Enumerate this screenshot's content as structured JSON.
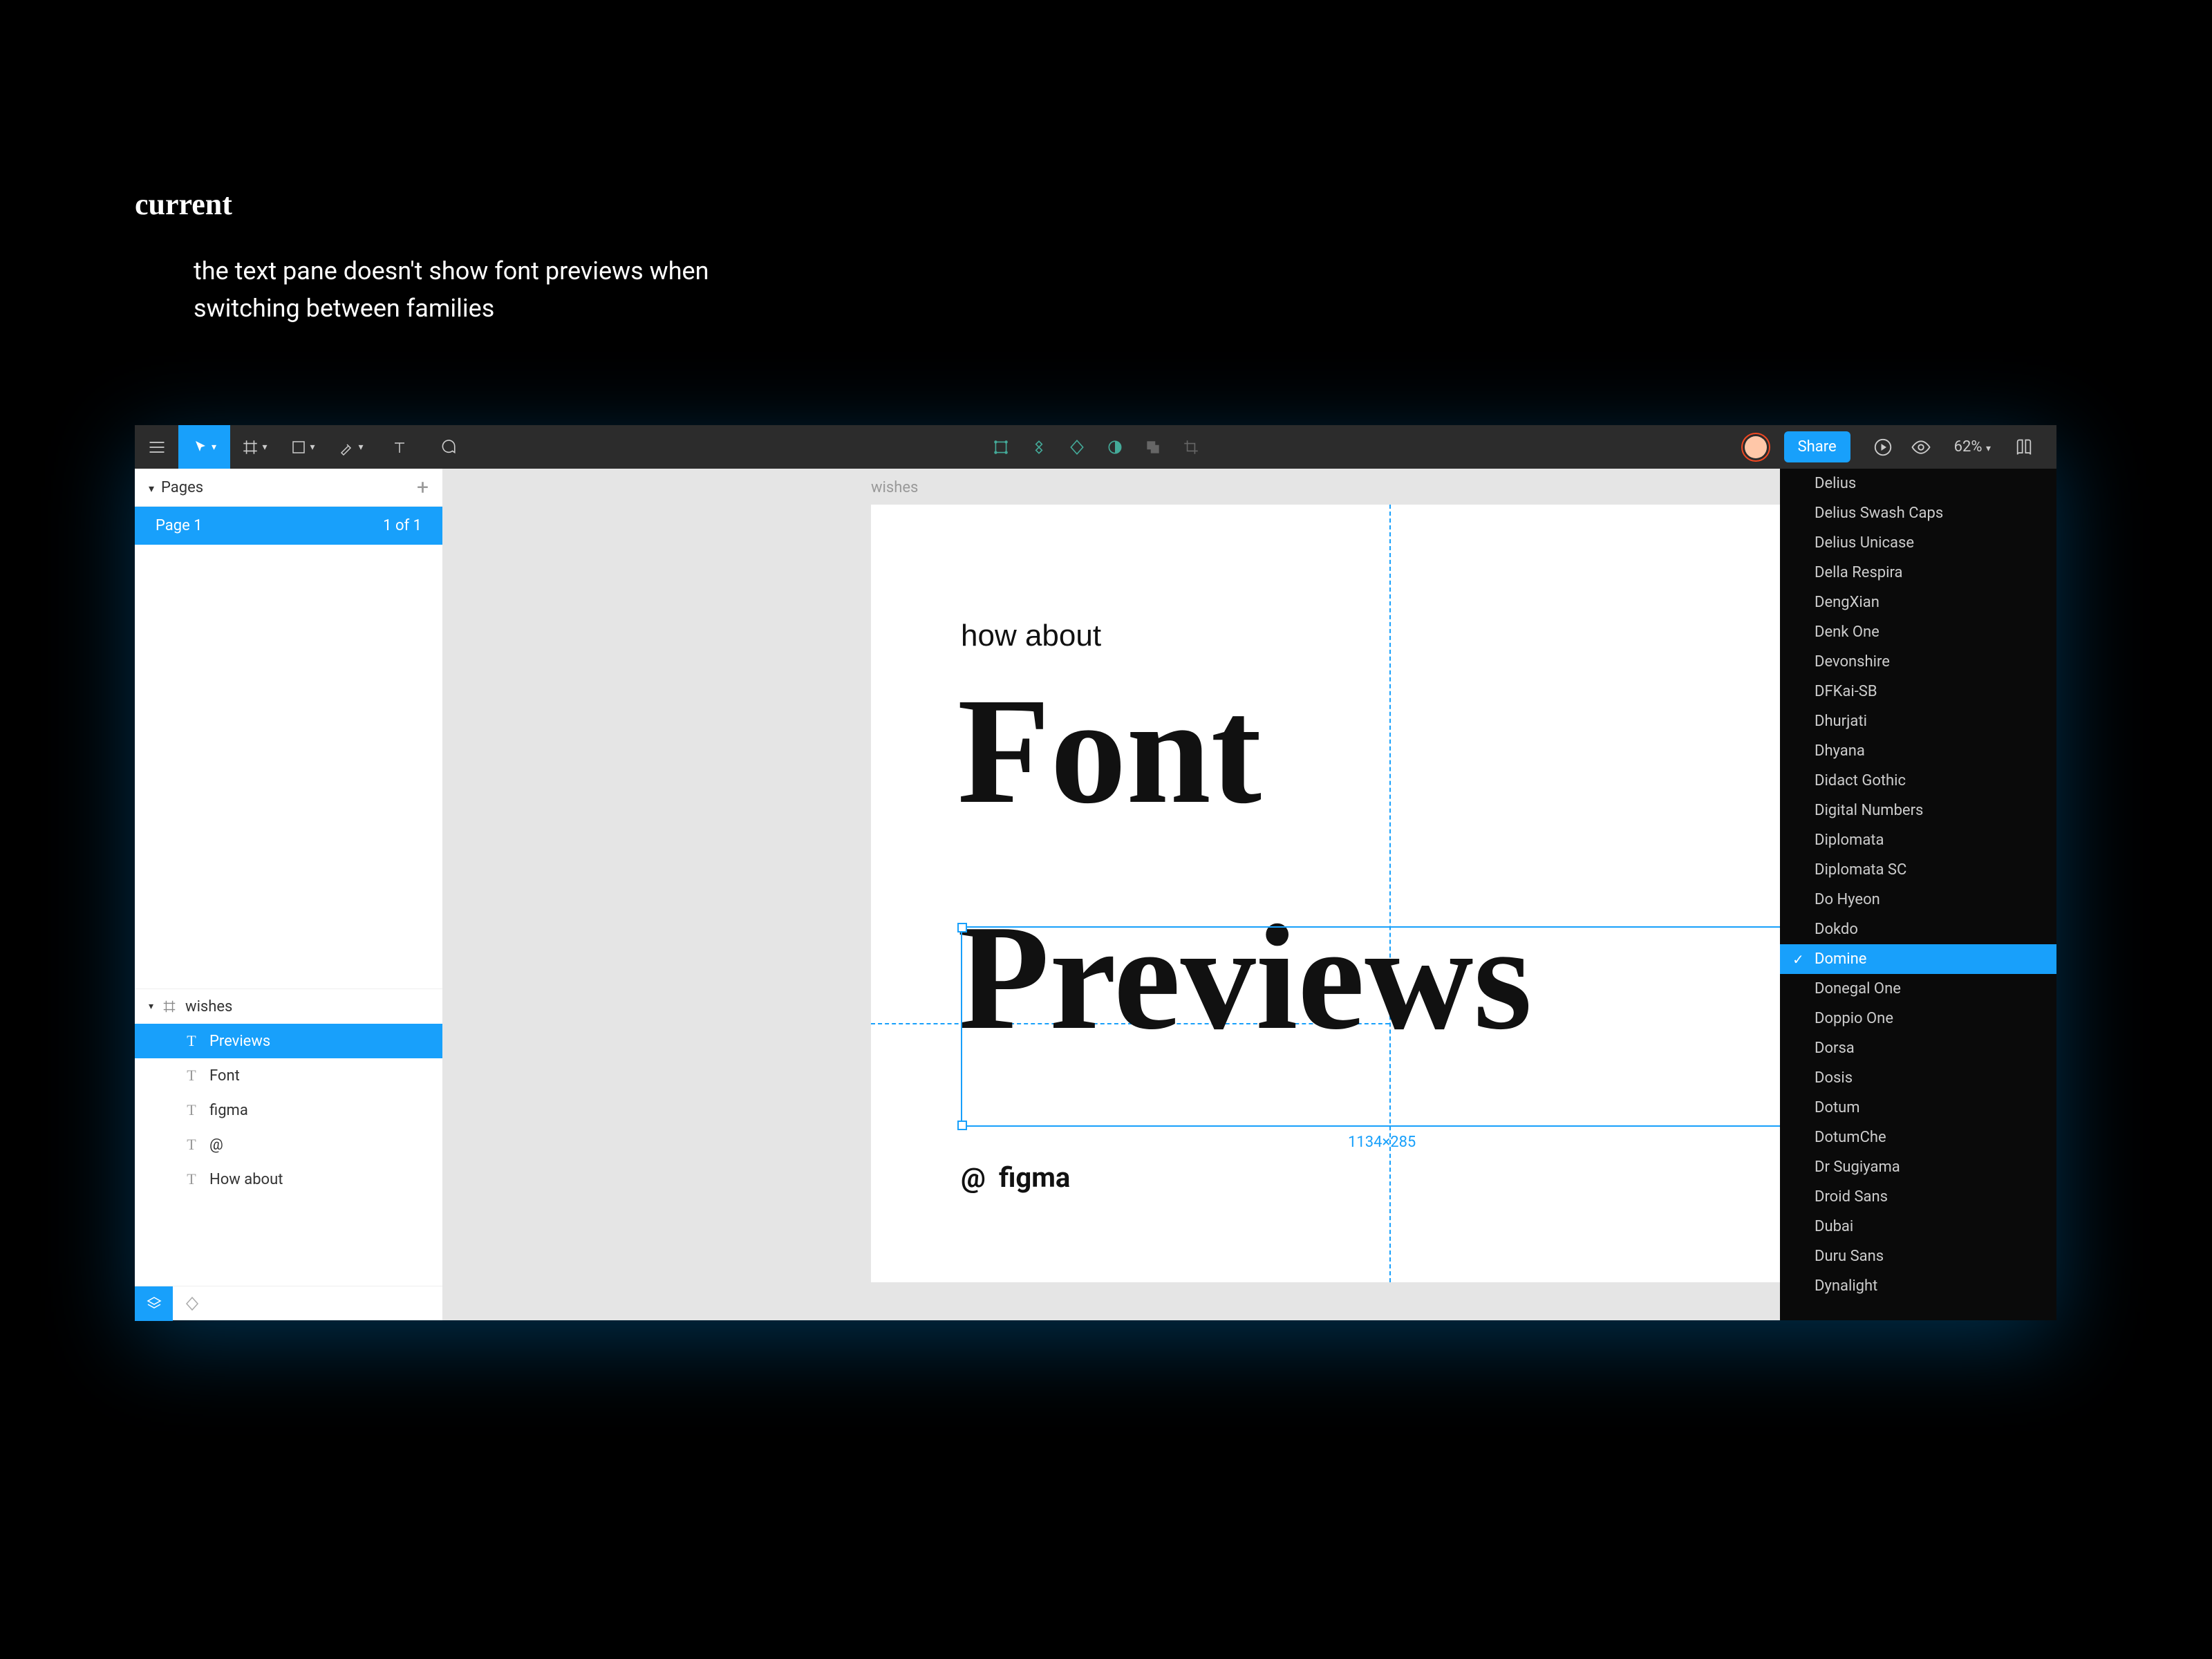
{
  "slide": {
    "title": "current",
    "desc_line1": "the text pane doesn't show font previews when",
    "desc_line2": "switching between families"
  },
  "toolbar": {
    "share_label": "Share",
    "zoom": "62%"
  },
  "pages": {
    "header": "Pages",
    "page_name": "Page 1",
    "page_count": "1 of 1"
  },
  "layers": {
    "root_name": "wishes",
    "items": [
      {
        "name": "Previews",
        "selected": true
      },
      {
        "name": "Font",
        "selected": false
      },
      {
        "name": "figma",
        "selected": false
      },
      {
        "name": "@",
        "selected": false
      },
      {
        "name": "How about",
        "selected": false
      }
    ]
  },
  "canvas": {
    "frame_label": "wishes",
    "text_small": "how about",
    "text_font": "Font",
    "text_previews": "Previews",
    "text_at": "@",
    "text_figma": "figma",
    "selection_dims": "1134×285"
  },
  "font_list": [
    "Delius",
    "Delius Swash Caps",
    "Delius Unicase",
    "Della Respira",
    "DengXian",
    "Denk One",
    "Devonshire",
    "DFKai-SB",
    "Dhurjati",
    "Dhyana",
    "Didact Gothic",
    "Digital Numbers",
    "Diplomata",
    "Diplomata SC",
    "Do Hyeon",
    "Dokdo",
    "Domine",
    "Donegal One",
    "Doppio One",
    "Dorsa",
    "Dosis",
    "Dotum",
    "DotumChe",
    "Dr Sugiyama",
    "Droid Sans",
    "Dubai",
    "Duru Sans",
    "Dynalight"
  ],
  "font_selected": "Domine"
}
